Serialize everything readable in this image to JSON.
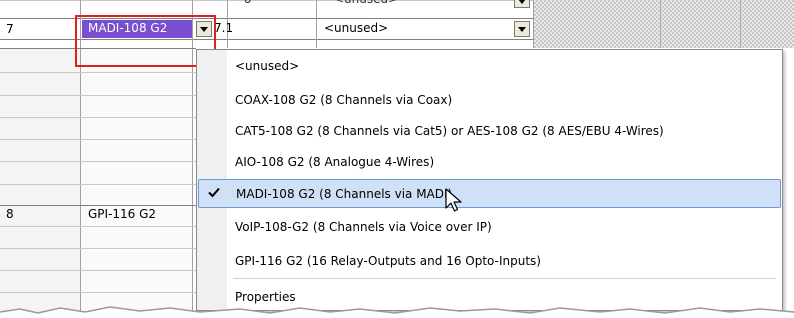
{
  "grid": {
    "prev_row": {
      "port": "o",
      "device": "<unused>"
    },
    "rows": [
      {
        "id": "7",
        "device": "MADI-108 G2",
        "port": "7.1",
        "device2": "<unused>"
      },
      {
        "id": "8",
        "device": "GPI-116 G2"
      }
    ]
  },
  "menu": {
    "items": [
      {
        "label": "<unused>",
        "checked": false
      },
      {
        "label": "COAX-108 G2 (8 Channels via Coax)",
        "checked": false
      },
      {
        "label": "CAT5-108 G2 (8 Channels via Cat5) or AES-108 G2 (8 AES/EBU 4-Wires)",
        "checked": false
      },
      {
        "label": "AIO-108 G2 (8 Analogue 4-Wires)",
        "checked": false
      },
      {
        "label": "MADI-108 G2 (8 Channels via MADI)",
        "checked": true
      },
      {
        "label": "VoIP-108-G2 (8 Channels via Voice over IP)",
        "checked": false
      },
      {
        "label": "GPI-116 G2 (16 Relay-Outputs and 16 Opto-Inputs)",
        "checked": false
      }
    ],
    "properties_label": "Properties"
  },
  "icons": {
    "dropdown": "chevron-down-icon",
    "check": "check-icon",
    "cursor": "mouse-pointer-icon"
  },
  "colors": {
    "selected_cell": "#7a4fcf",
    "highlight": "#cfe0f7",
    "highlight_border": "#6d9ad7",
    "annotation": "#e0201b"
  }
}
